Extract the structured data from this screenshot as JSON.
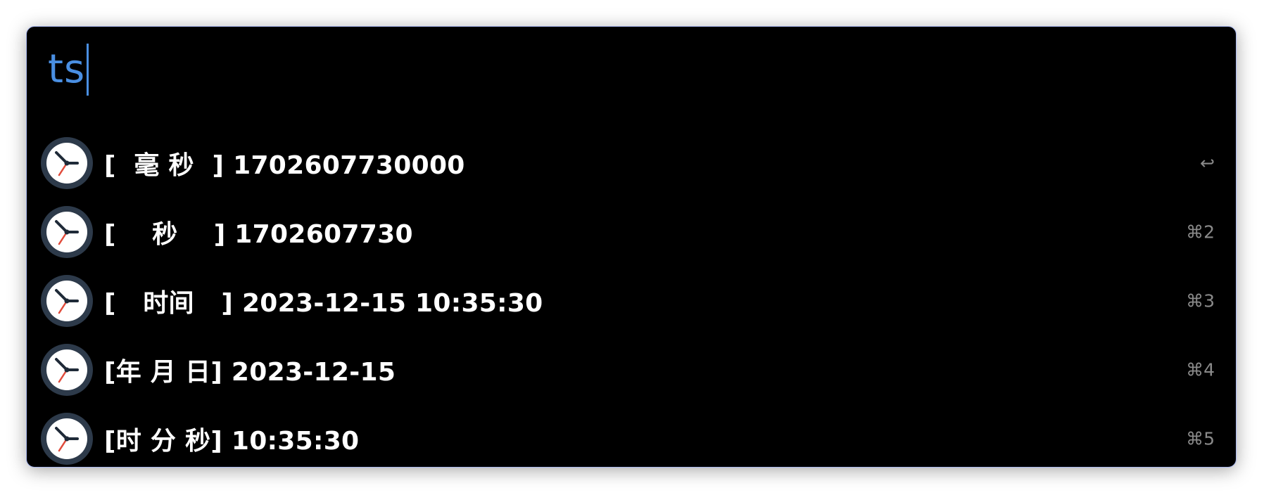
{
  "search": {
    "query": "ts"
  },
  "colors": {
    "accent": "#4a8fe2",
    "background": "#000000",
    "border": "#a9b7ef",
    "text": "#ffffff",
    "shortcut": "#8a8a8a"
  },
  "results": [
    {
      "label": "[  毫 秒  ] 1702607730000",
      "icon": "clock-icon",
      "shortcut": "↩"
    },
    {
      "label": "[    秒    ] 1702607730",
      "icon": "clock-icon",
      "shortcut": "⌘2"
    },
    {
      "label": "[   时间   ] 2023-12-15 10:35:30",
      "icon": "clock-icon",
      "shortcut": "⌘3"
    },
    {
      "label": "[年 月 日] 2023-12-15",
      "icon": "clock-icon",
      "shortcut": "⌘4"
    },
    {
      "label": "[时 分 秒] 10:35:30",
      "icon": "clock-icon",
      "shortcut": "⌘5"
    }
  ]
}
